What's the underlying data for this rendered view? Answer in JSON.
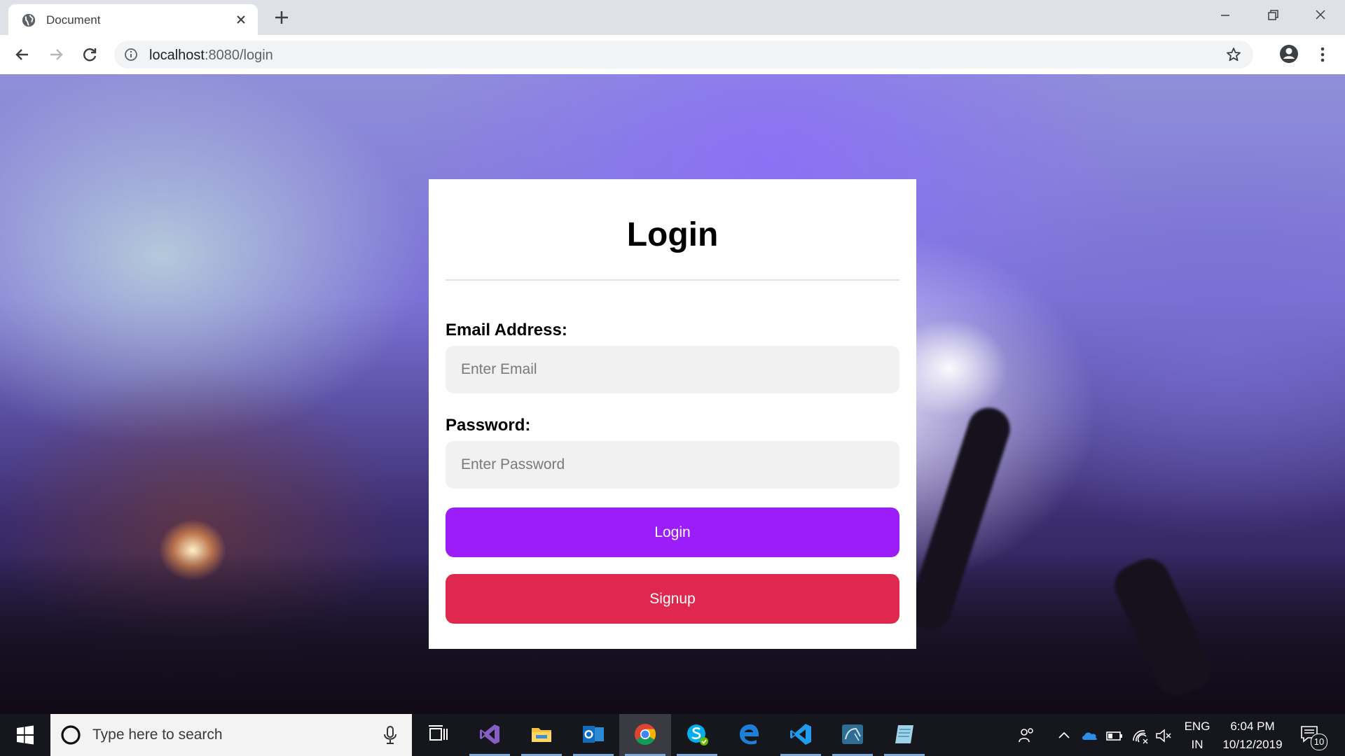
{
  "browser": {
    "tab": {
      "title": "Document"
    },
    "address": {
      "host": "localhost",
      "path": ":8080/login"
    }
  },
  "login_form": {
    "title": "Login",
    "email": {
      "label": "Email Address:",
      "placeholder": "Enter Email",
      "value": ""
    },
    "password": {
      "label": "Password:",
      "placeholder": "Enter Password",
      "value": ""
    },
    "login_button": "Login",
    "signup_button": "Signup",
    "colors": {
      "login": "#9b1efa",
      "signup": "#e0284f"
    }
  },
  "taskbar": {
    "search_placeholder": "Type here to search",
    "apps": [
      "task-view",
      "visual-studio",
      "file-explorer",
      "outlook",
      "chrome",
      "skype",
      "edge",
      "vs-code",
      "mysql-workbench",
      "notepad"
    ],
    "active_app": "chrome",
    "tray": {
      "language": "ENG",
      "region": "IN",
      "time": "6:04 PM",
      "date": "10/12/2019",
      "notifications": "10"
    }
  }
}
